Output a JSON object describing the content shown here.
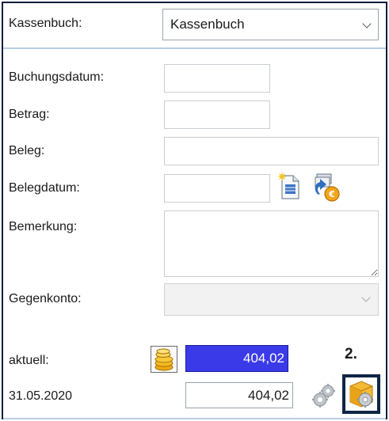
{
  "kassenbuch": {
    "label": "Kassenbuch:",
    "selected": "Kassenbuch"
  },
  "form": {
    "buchungsdatum_label": "Buchungsdatum:",
    "betrag_label": "Betrag:",
    "beleg_label": "Beleg:",
    "belegdatum_label": "Belegdatum:",
    "bemerkung_label": "Bemerkung:",
    "gegenkonto_label": "Gegenkonto:"
  },
  "balance": {
    "aktuell_label": "aktuell:",
    "aktuell_value": "404,02",
    "date_label": "31.05.2020",
    "date_value": "404,02"
  },
  "annotation": {
    "step": "2."
  },
  "icons": {
    "new_document": "new-document-icon",
    "money_swap": "money-swap-icon",
    "coins": "coins-icon",
    "gears": "gears-icon",
    "box_gear": "box-gear-icon"
  },
  "colors": {
    "highlight_border": "#0e2547",
    "amount_bg": "#3a3ae8",
    "divider": "#b8cde6"
  }
}
